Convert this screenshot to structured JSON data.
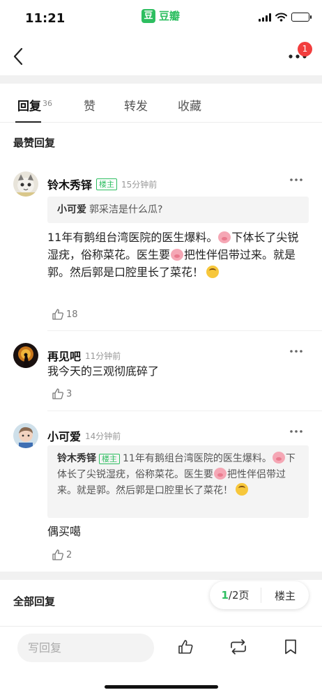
{
  "status_bar": {
    "time": "11:21",
    "app_logo_char": "豆",
    "app_name": "豆瓣"
  },
  "nav": {
    "back_icon": "chevron-left-icon",
    "more_icon": "more-dots-icon",
    "notification_count": "1"
  },
  "tabs": [
    {
      "label": "回复",
      "count": "36",
      "active": true
    },
    {
      "label": "赞"
    },
    {
      "label": "转发"
    },
    {
      "label": "收藏"
    }
  ],
  "sections": {
    "top_replies": "最赞回复",
    "all_replies": "全部回复"
  },
  "comments": [
    {
      "name": "铃木秀铎",
      "is_op": true,
      "op_badge": "楼主",
      "time": "15分钟前",
      "quote": {
        "name": "小可爱",
        "text": "郭采洁是什么瓜?"
      },
      "text_parts": [
        "11年有鹅组台湾医院的医生爆料。",
        "下体长了尖锐湿疣，俗称菜花。医生要",
        "把性伴侣带过来。就是郭。然后郭是口腔里长了菜花！"
      ],
      "likes": "18"
    },
    {
      "name": "再见吧",
      "time": "11分钟前",
      "text": "我今天的三观彻底碎了",
      "likes": "3"
    },
    {
      "name": "小可爱",
      "time": "14分钟前",
      "quote": {
        "name": "铃木秀铎",
        "op_badge": "楼主",
        "text_parts": [
          "11年有鹅组台湾医院的医生爆料。",
          "下体长了尖锐湿疣，俗称菜花。医生要",
          "把性伴侣带过来。就是郭。然后郭是口腔里长了菜花！"
        ]
      },
      "text": "偶买噶",
      "likes": "2"
    }
  ],
  "pager": {
    "current": "1",
    "total_label": "/2页",
    "op_only": "楼主"
  },
  "bottom_bar": {
    "reply_placeholder": "写回复",
    "icons": [
      "like-icon",
      "repost-icon",
      "bookmark-icon"
    ]
  },
  "colors": {
    "brand_green": "#2dbe60",
    "badge_red": "#f23e3e"
  }
}
